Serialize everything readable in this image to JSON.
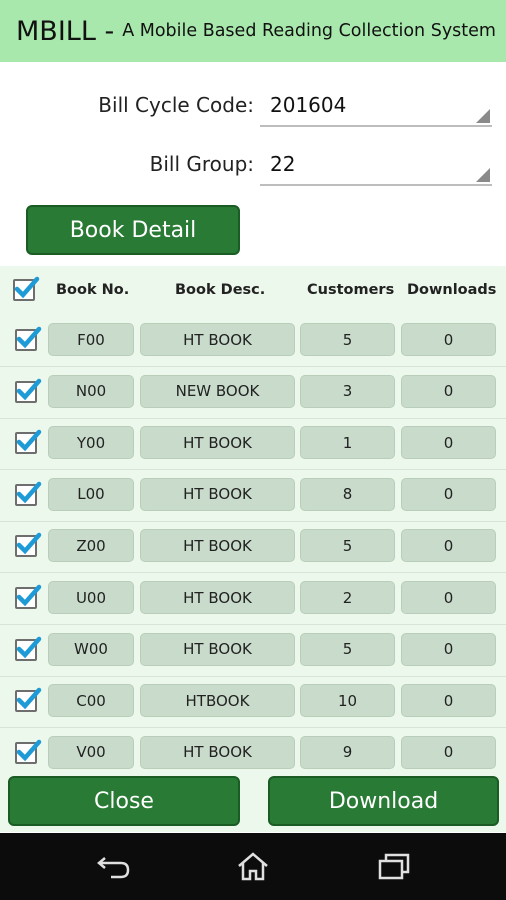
{
  "header": {
    "app_name": "MBILL -",
    "subtitle": "A Mobile Based Reading Collection System"
  },
  "form": {
    "bill_cycle_label": "Bill Cycle Code:",
    "bill_cycle_value": "201604",
    "bill_group_label": "Bill Group:",
    "bill_group_value": "22"
  },
  "book_detail_button": "Book Detail",
  "table": {
    "headers": {
      "book_no": "Book No.",
      "book_desc": "Book Desc.",
      "customers": "Customers",
      "downloads": "Downloads"
    },
    "select_all_checked": true,
    "rows": [
      {
        "checked": true,
        "book_no": "F00",
        "book_desc": "HT BOOK",
        "customers": "5",
        "downloads": "0"
      },
      {
        "checked": true,
        "book_no": "N00",
        "book_desc": "NEW BOOK",
        "customers": "3",
        "downloads": "0"
      },
      {
        "checked": true,
        "book_no": "Y00",
        "book_desc": "HT BOOK",
        "customers": "1",
        "downloads": "0"
      },
      {
        "checked": true,
        "book_no": "L00",
        "book_desc": "HT BOOK",
        "customers": "8",
        "downloads": "0"
      },
      {
        "checked": true,
        "book_no": "Z00",
        "book_desc": "HT BOOK",
        "customers": "5",
        "downloads": "0"
      },
      {
        "checked": true,
        "book_no": "U00",
        "book_desc": "HT BOOK",
        "customers": "2",
        "downloads": "0"
      },
      {
        "checked": true,
        "book_no": "W00",
        "book_desc": "HT BOOK",
        "customers": "5",
        "downloads": "0"
      },
      {
        "checked": true,
        "book_no": "C00",
        "book_desc": "HTBOOK",
        "customers": "10",
        "downloads": "0"
      },
      {
        "checked": true,
        "book_no": "V00",
        "book_desc": "HT BOOK",
        "customers": "9",
        "downloads": "0"
      }
    ]
  },
  "footer": {
    "close_label": "Close",
    "download_label": "Download"
  },
  "navbar": {
    "icons": [
      "back-icon",
      "home-icon",
      "recents-icon"
    ]
  },
  "colors": {
    "header_bg": "#a9e8ac",
    "button_green": "#287a34",
    "table_bg": "#ecf8ec",
    "cell_bg": "#c9dccb",
    "checkmark": "#1e9bd7",
    "navbar_bg": "#0c0c0c"
  }
}
